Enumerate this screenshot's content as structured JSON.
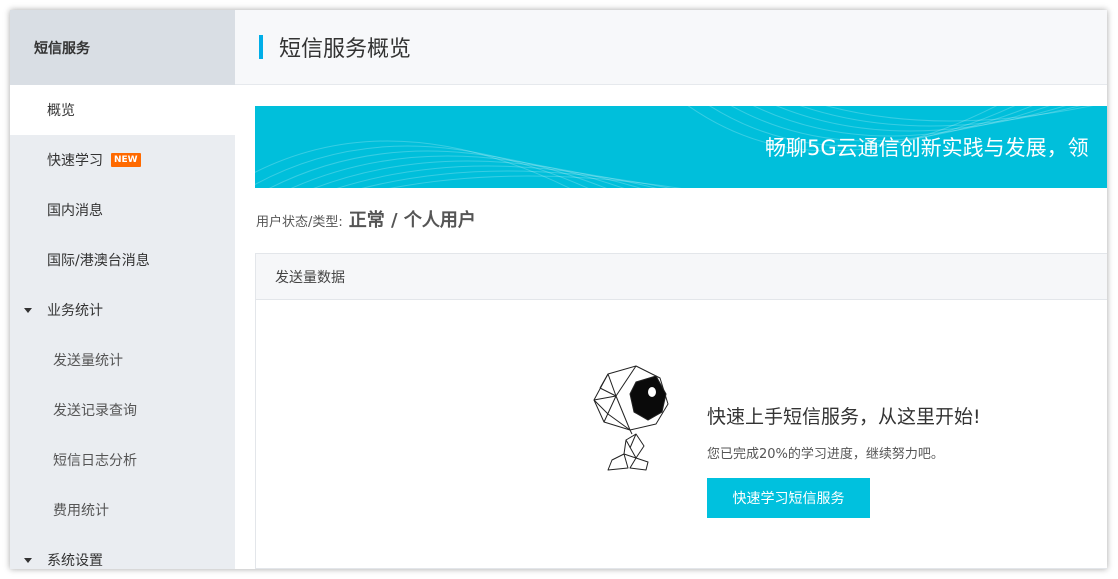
{
  "sidebar": {
    "title": "短信服务",
    "items": [
      {
        "label": "概览"
      },
      {
        "label": "快速学习",
        "badge": "NEW"
      },
      {
        "label": "国内消息"
      },
      {
        "label": "国际/港澳台消息"
      }
    ],
    "groups": [
      {
        "label": "业务统计",
        "children": [
          "发送量统计",
          "发送记录查询",
          "短信日志分析",
          "费用统计"
        ]
      },
      {
        "label": "系统设置"
      }
    ]
  },
  "header": {
    "title": "短信服务概览"
  },
  "banner": {
    "text": "畅聊5G云通信创新实践与发展，领"
  },
  "status": {
    "label": "用户状态/类型:",
    "value": "正常 / 个人用户"
  },
  "panel": {
    "title": "发送量数据",
    "cta_title": "快速上手短信服务，从这里开始!",
    "cta_desc": "您已完成20%的学习进度，继续努力吧。",
    "cta_button": "快速学习短信服务",
    "progress_percent": 20
  },
  "colors": {
    "accent": "#00c1de",
    "banner": "#00bfdb",
    "new_badge": "#ff6a00",
    "sidebar_bg": "#eaedf1"
  }
}
